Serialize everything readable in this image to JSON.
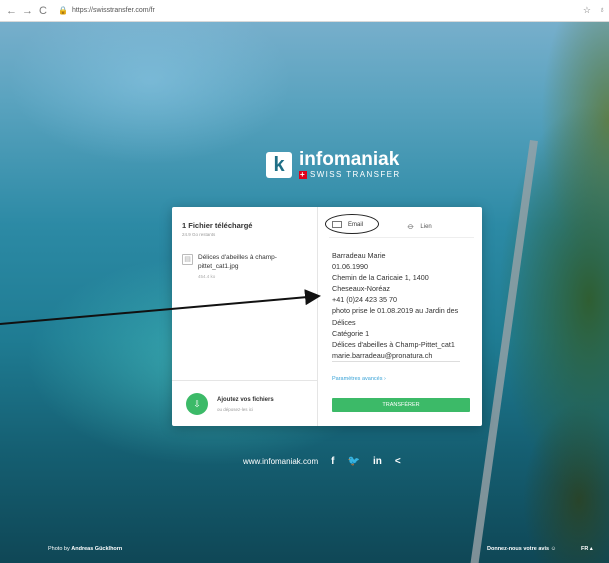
{
  "browser": {
    "back": "←",
    "forward": "→",
    "reload": "C",
    "lock": "🔒",
    "url": "https://swisstransfer.com/fr",
    "star": "☆",
    "ext": "♁"
  },
  "brand": {
    "mark": "k",
    "name": "infomaniak",
    "flag": "+",
    "product": "SWISS TRANSFER"
  },
  "files": {
    "title": "1 Fichier téléchargé",
    "remaining": "24.9 Go restants",
    "file_icon": "▤",
    "items": [
      {
        "name": "Délices d'abeilles à champ-pittet_cat1.jpg",
        "size": "454.4 ko"
      }
    ],
    "add_icon": "⇩",
    "add_label": "Ajoutez vos fichiers",
    "add_sub": "ou déposez-les ici"
  },
  "share": {
    "tabs": {
      "email": "Email",
      "link": "Lien",
      "link_icon": "⌀"
    },
    "message": "Barradeau Marie\n01.06.1990\nChemin de la Caricaie 1, 1400\nCheseaux-Noréaz\n+41 (0)24 423 35 70\nphoto prise le 01.08.2019 au Jardin des Délices\nCatégorie 1\nDélices d'abeilles à Champ-Pittet_cat1\nmarie.barradeau@pronatura.ch",
    "advanced": "Paramètres avancés ›",
    "send": "TRANSFÉRER"
  },
  "footer": {
    "url": "www.infomaniak.com",
    "facebook": "f",
    "twitter": "🐦",
    "linkedin": "in",
    "share": "<",
    "credit_prefix": "Photo by ",
    "credit_name": "Andreas Gücklhorn",
    "feedback": "Donnez-nous votre avis",
    "feedback_icon": "☺",
    "lang": "FR ▴"
  },
  "colors": {
    "accent_green": "#3cba68",
    "link_blue": "#39a3d7",
    "swiss_red": "#e1001a"
  }
}
